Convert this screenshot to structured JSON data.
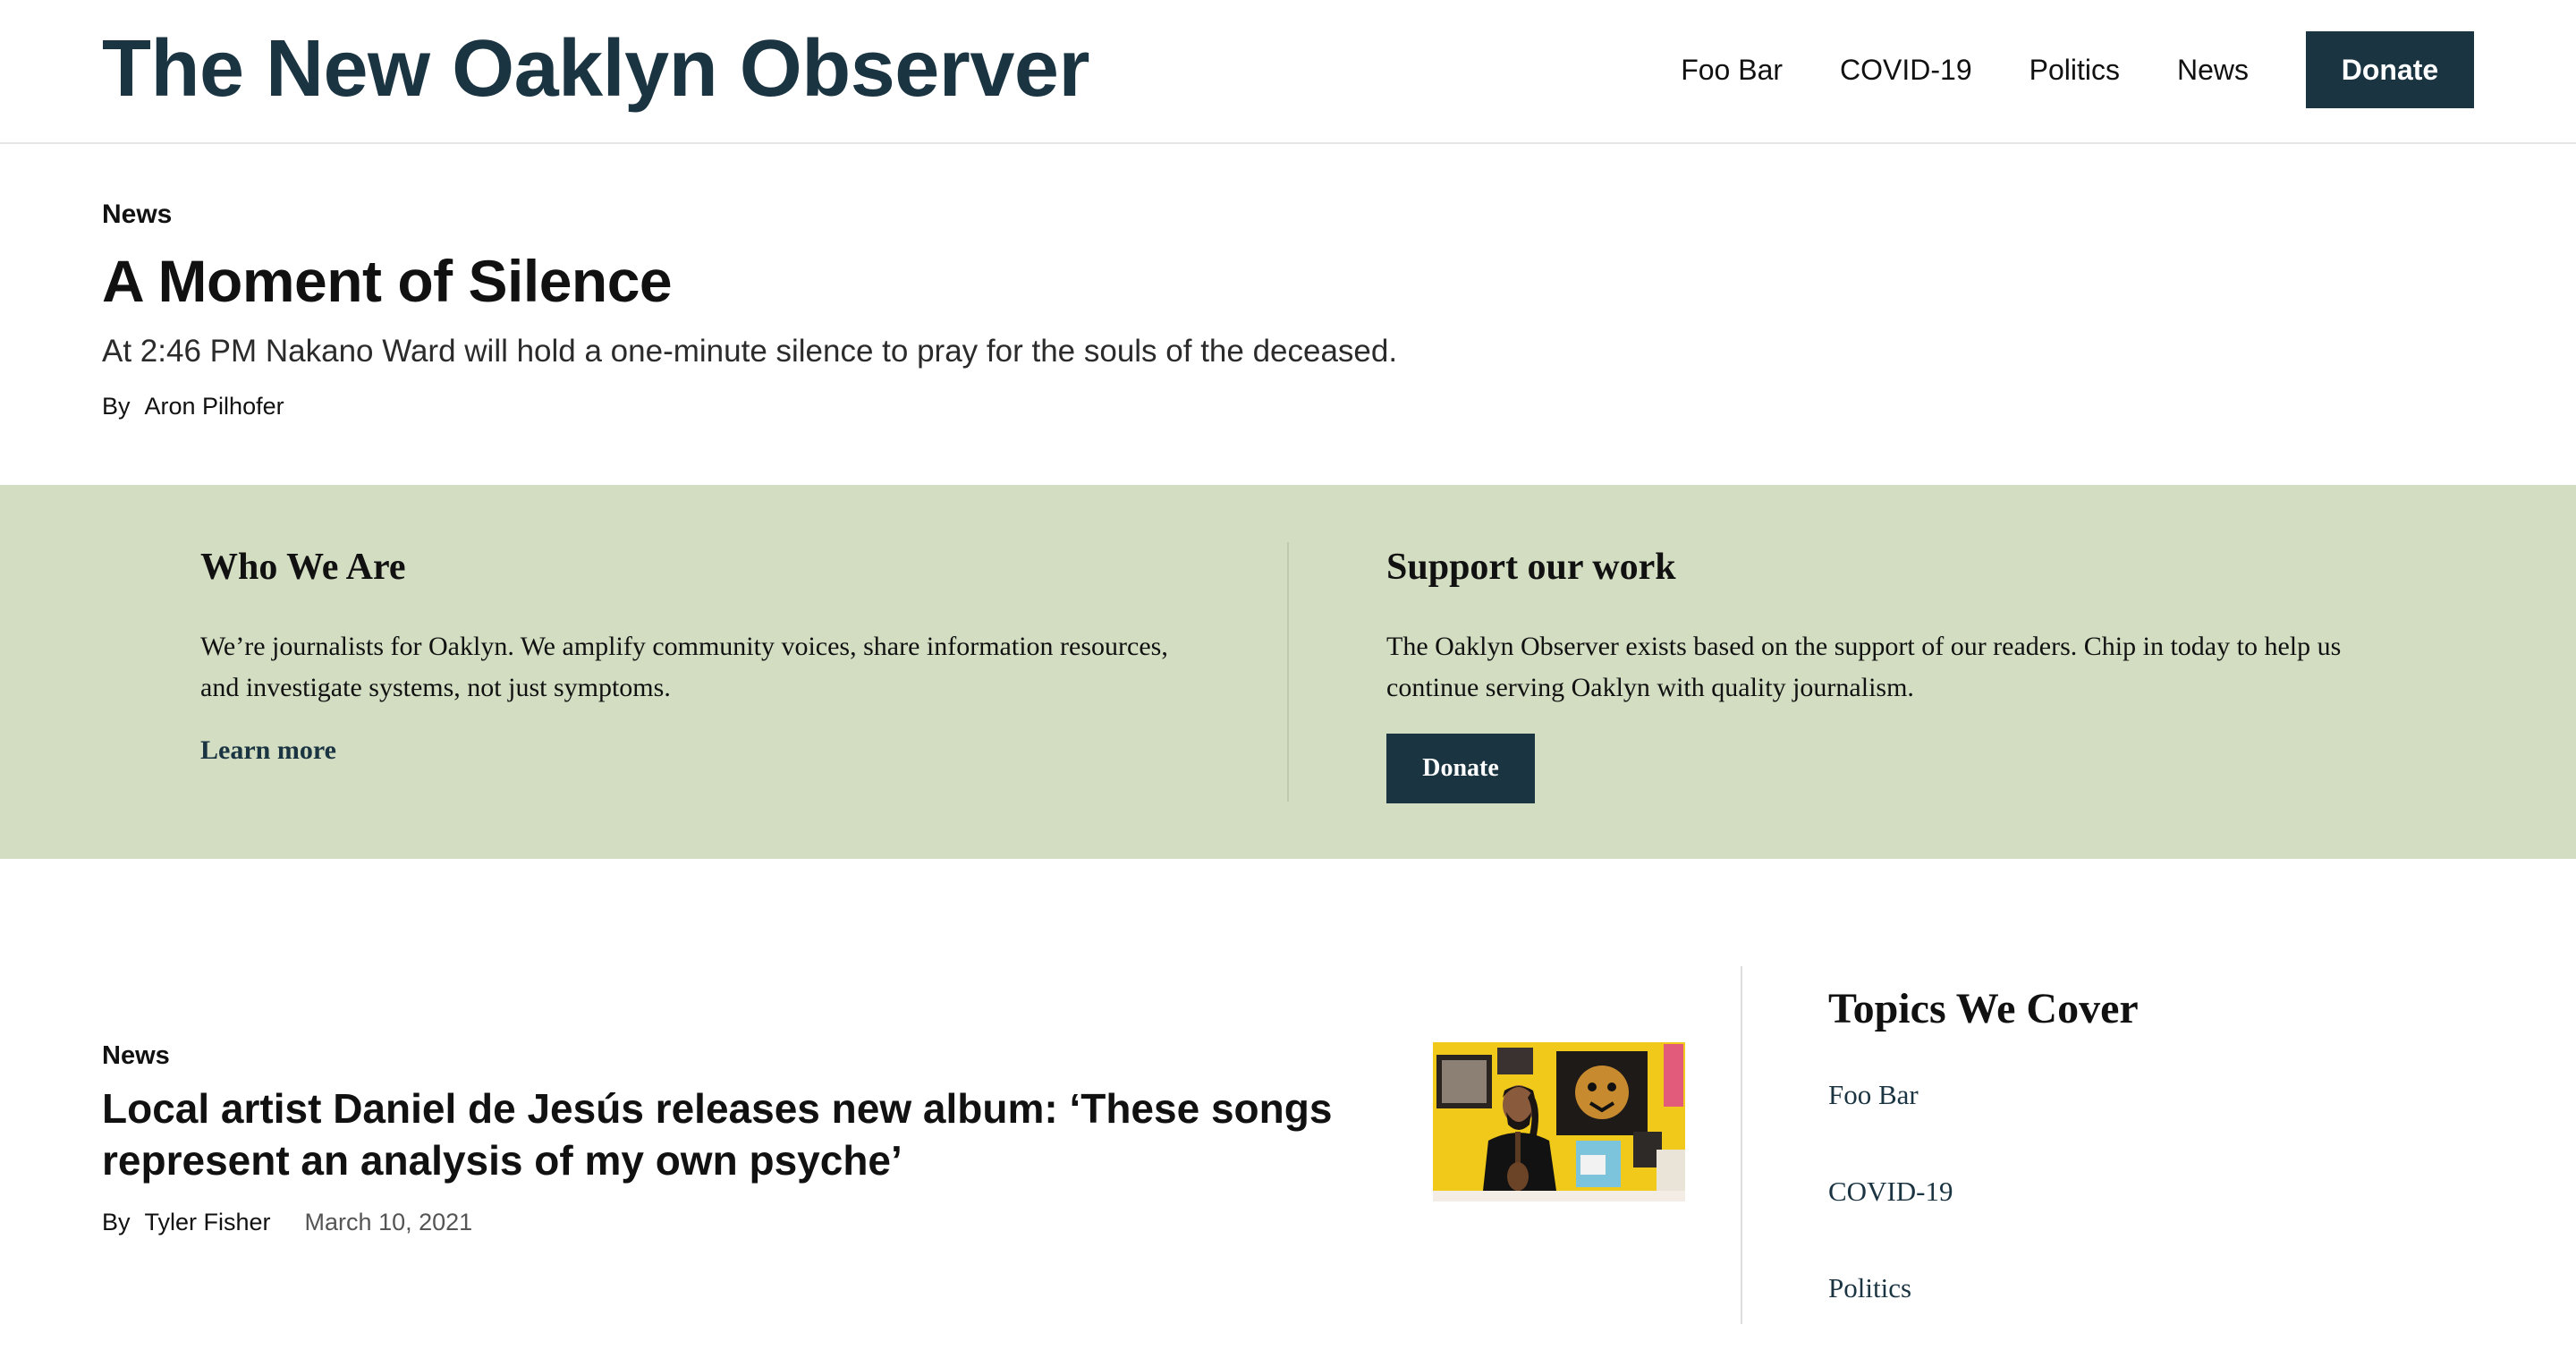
{
  "header": {
    "site_title": "The New Oaklyn Observer",
    "nav": [
      "Foo Bar",
      "COVID-19",
      "Politics",
      "News"
    ],
    "donate_label": "Donate"
  },
  "feature": {
    "section": "News",
    "headline": "A Moment of Silence",
    "dek": "At 2:46 PM Nakano Ward will hold a one-minute silence to pray for the souls of the deceased.",
    "byline_label": "By",
    "author": "Aron Pilhofer"
  },
  "promo": {
    "who": {
      "heading": "Who We Are",
      "text": "We’re journalists for Oaklyn. We amplify community voices, share information resources, and investigate systems, not just symptoms.",
      "link_label": "Learn more"
    },
    "support": {
      "heading": "Support our work",
      "text": "The Oaklyn Observer exists based on the support of our readers. Chip in today to help us continue serving Oaklyn with quality journalism.",
      "button_label": "Donate"
    }
  },
  "story": {
    "section": "News",
    "headline": "Local artist Daniel de Jesús releases new album: ‘These songs represent an analysis of my own psyche’",
    "byline_label": "By",
    "author": "Tyler Fisher",
    "date": "March 10, 2021"
  },
  "sidebar": {
    "heading": "Topics We Cover",
    "topics": [
      "Foo Bar",
      "COVID-19",
      "Politics"
    ]
  },
  "colors": {
    "brand": "#1b3442",
    "promo_bg": "#d2ddc2"
  }
}
